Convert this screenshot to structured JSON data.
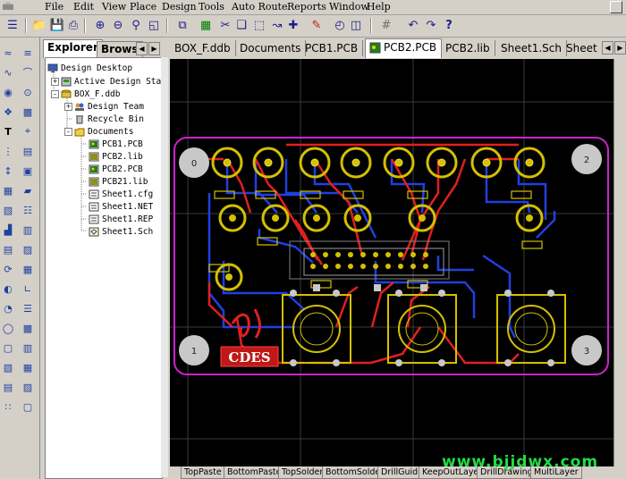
{
  "menubar": {
    "items": [
      "File",
      "Edit",
      "View",
      "Place",
      "Design",
      "Tools",
      "Auto Route",
      "Reports",
      "Window",
      "Help"
    ]
  },
  "panel": {
    "tabs": [
      "Explorer",
      "Brows"
    ],
    "tree": [
      {
        "label": "Design Desktop",
        "icon": "desktop-icon"
      },
      {
        "label": "Active Design Sta",
        "icon": "station-icon"
      },
      {
        "label": "BOX_F.ddb",
        "icon": "database-icon"
      },
      {
        "label": "Design Team",
        "icon": "team-icon"
      },
      {
        "label": "Recycle Bin",
        "icon": "recycle-bin-icon"
      },
      {
        "label": "Documents",
        "icon": "folder-icon"
      },
      {
        "label": "PCB1.PCB",
        "icon": "pcb-file-icon"
      },
      {
        "label": "PCB2.lib",
        "icon": "lib-file-icon"
      },
      {
        "label": "PCB2.PCB",
        "icon": "pcb-file-icon"
      },
      {
        "label": "PCB21.lib",
        "icon": "lib-file-icon"
      },
      {
        "label": "Sheet1.cfg",
        "icon": "cfg-file-icon"
      },
      {
        "label": "Sheet1.NET",
        "icon": "net-file-icon"
      },
      {
        "label": "Sheet1.REP",
        "icon": "rep-file-icon"
      },
      {
        "label": "Sheet1.Sch",
        "icon": "sch-file-icon"
      }
    ]
  },
  "doctabs": [
    "BOX_F.ddb",
    "Documents",
    "PCB1.PCB",
    "PCB2.PCB",
    "PCB2.lib",
    "Sheet1.Sch",
    "Sheet"
  ],
  "pcb": {
    "mounting_holes": [
      "0",
      "2",
      "1",
      "3"
    ],
    "silk_logo": "CDES",
    "colors": {
      "board_outline": "#d020d0",
      "pad": "#d4c000",
      "top_trace": "#e02020",
      "bottom_trace": "#2040e0",
      "hole": "#c8c8c8",
      "grid": "#2a2a2a"
    }
  },
  "layers": [
    "TopPaste",
    "BottomPaste",
    "TopSolder",
    "BottomSolder",
    "DrillGuide",
    "KeepOutLayer",
    "DrillDrawing",
    "MultiLayer"
  ],
  "watermark": "www.bjjdwx.com"
}
